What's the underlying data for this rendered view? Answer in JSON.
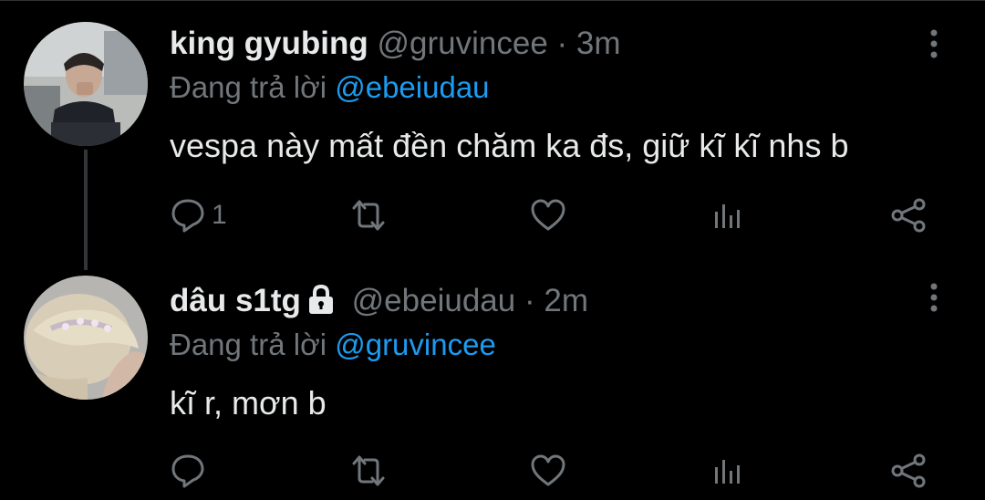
{
  "colors": {
    "background": "#000000",
    "text_primary": "#e7e9ea",
    "text_secondary": "#71767b",
    "link": "#1d9bf0",
    "thread_line": "#333639"
  },
  "tweets": [
    {
      "display_name": "king gyubing",
      "handle": "@gruvincee",
      "separator": "·",
      "time": "3m",
      "protected": false,
      "replying_to_label": "Đang trả lời",
      "replying_to_handle": "@ebeiudau",
      "text": "vespa này mất đền chăm ka đs, giữ kĩ kĩ nhs b",
      "reply_count": "1",
      "retweet_count": "",
      "like_count": "",
      "icons": [
        "reply-icon",
        "retweet-icon",
        "like-icon",
        "views-icon",
        "share-icon",
        "more-icon"
      ]
    },
    {
      "display_name": "dâu s1tg",
      "handle": "@ebeiudau",
      "separator": "·",
      "time": "2m",
      "protected": true,
      "replying_to_label": "Đang trả lời",
      "replying_to_handle": "@gruvincee",
      "text": "kĩ r, mơn b",
      "reply_count": "",
      "retweet_count": "",
      "like_count": "",
      "icons": [
        "reply-icon",
        "retweet-icon",
        "like-icon",
        "views-icon",
        "share-icon",
        "more-icon",
        "lock-icon"
      ]
    }
  ]
}
